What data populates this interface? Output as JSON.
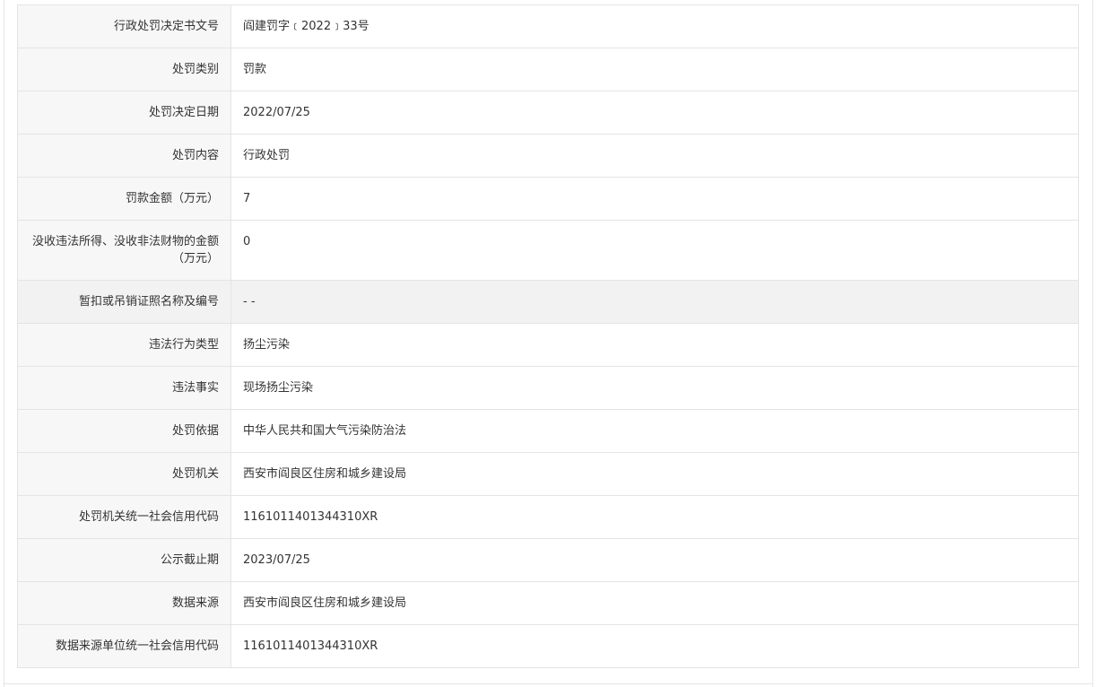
{
  "rows": [
    {
      "label": "行政处罚决定书文号",
      "value": "阎建罚字﹝2022﹞33号"
    },
    {
      "label": "处罚类别",
      "value": "罚款"
    },
    {
      "label": "处罚决定日期",
      "value": "2022/07/25"
    },
    {
      "label": "处罚内容",
      "value": "行政处罚"
    },
    {
      "label": "罚款金额（万元）",
      "value": "7"
    },
    {
      "label": "没收违法所得、没收非法财物的金额（万元）",
      "value": "0"
    },
    {
      "label": "暂扣或吊销证照名称及编号",
      "value": "- -"
    },
    {
      "label": "违法行为类型",
      "value": "扬尘污染"
    },
    {
      "label": "违法事实",
      "value": "现场扬尘污染"
    },
    {
      "label": "处罚依据",
      "value": "中华人民共和国大气污染防治法"
    },
    {
      "label": "处罚机关",
      "value": "西安市阎良区住房和城乡建设局"
    },
    {
      "label": "处罚机关统一社会信用代码",
      "value": "1161011401344310XR"
    },
    {
      "label": "公示截止期",
      "value": "2023/07/25"
    },
    {
      "label": "数据来源",
      "value": "西安市阎良区住房和城乡建设局"
    },
    {
      "label": "数据来源单位统一社会信用代码",
      "value": "1161011401344310XR"
    }
  ]
}
